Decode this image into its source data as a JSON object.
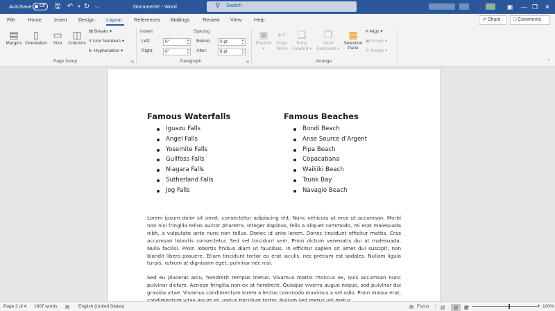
{
  "titlebar": {
    "autosave_label": "AutoSave",
    "autosave_state": "Off",
    "doc_title": "Document2 - Word",
    "search_placeholder": "Search"
  },
  "tabs": [
    "File",
    "Home",
    "Insert",
    "Design",
    "Layout",
    "References",
    "Mailings",
    "Review",
    "View",
    "Help"
  ],
  "active_tab": "Layout",
  "share_label": "Share",
  "comments_label": "Comments",
  "ribbon": {
    "page_setup": {
      "margins": "Margins",
      "orientation": "Orientation",
      "size": "Size",
      "columns": "Columns",
      "breaks": "Breaks",
      "line_numbers": "Line Numbers",
      "hyphenation": "Hyphenation",
      "group_label": "Page Setup"
    },
    "paragraph": {
      "indent_head": "Indent",
      "spacing_head": "Spacing",
      "left_label": "Left:",
      "left_value": "0\"",
      "right_label": "Right:",
      "right_value": "0\"",
      "before_label": "Before:",
      "before_value": "0 pt",
      "after_label": "After:",
      "after_value": "8 pt",
      "group_label": "Paragraph"
    },
    "arrange": {
      "position": "Position",
      "wrap_text_1": "Wrap",
      "wrap_text_2": "Text",
      "bring_forward_1": "Bring",
      "bring_forward_2": "Forward",
      "send_backward_1": "Send",
      "send_backward_2": "Backward",
      "selection_pane_1": "Selection",
      "selection_pane_2": "Pane",
      "align": "Align",
      "group": "Group",
      "rotate": "Rotate",
      "group_label": "Arrange"
    }
  },
  "document": {
    "col1_title": "Famous Waterfalls",
    "col1_items": [
      "Iguazu Falls",
      "Angel Falls",
      "Yosemite Falls",
      "Gullfoss Falls",
      "Niagara Falls",
      "Sutherland Falls",
      "Jog Falls"
    ],
    "col2_title": "Famous Beaches",
    "col2_items": [
      "Bondi Beach",
      "Anse Source d’Argent",
      "Pipa Beach",
      "Copacabana",
      "Waikiki Beach",
      "Trunk Bay",
      "Navagio Beach"
    ],
    "para1": "Lorem ipsum dolor sit amet, consectetur adipiscing elit. Nunc vehicula ut eros ut accumsan. Morbi non nisi fringilla tellus auctor pharetra. Integer dapibus, felis a aliquet commodo, mi erat malesuada nibh, a vulputate ante nunc non tellus. Donec id ante lorem. Donec tincidunt efficitur mattis. Cras accumsan lobortis consectetur. Sed vel tincidunt sem. Proin dictum venenatis dui at malesuada. Nulla facilisi. Proin lobortis finibus diam ut faucibus. In efficitur sapien sit amet dui suscipit, non blandit libero posuere. Etiam tincidunt tortor eu erat iaculis, nec pretium est sodales. Nullam ligula turpis, rutrum at dignissim eget, pulvinar nec nisi.",
    "para2": "Sed eu placerat arcu, hendrerit tempus metus. Vivamus mattis rhoncus ex, quis accumsan nunc pulvinar dictum. Aenean fringilla non ex at hendrerit. Quisque viverra augue neque, sed pulvinar dui gravida vitae. Vivamus condimentum lorem a lectus commodo maximus a vel odio. Proin massa erat, condimentum vitae ipsum et, varius tincidunt tortor. Nullam sed metus vel metus"
  },
  "statusbar": {
    "page": "Page 2 of 4",
    "words": "1607 words",
    "language": "English (United States)",
    "focus": "Focus",
    "zoom": "100%"
  },
  "colors": {
    "accent": "#2b579a",
    "ribbon_bg": "#f3f3f3",
    "canvas_bg": "#e6e6e6"
  }
}
